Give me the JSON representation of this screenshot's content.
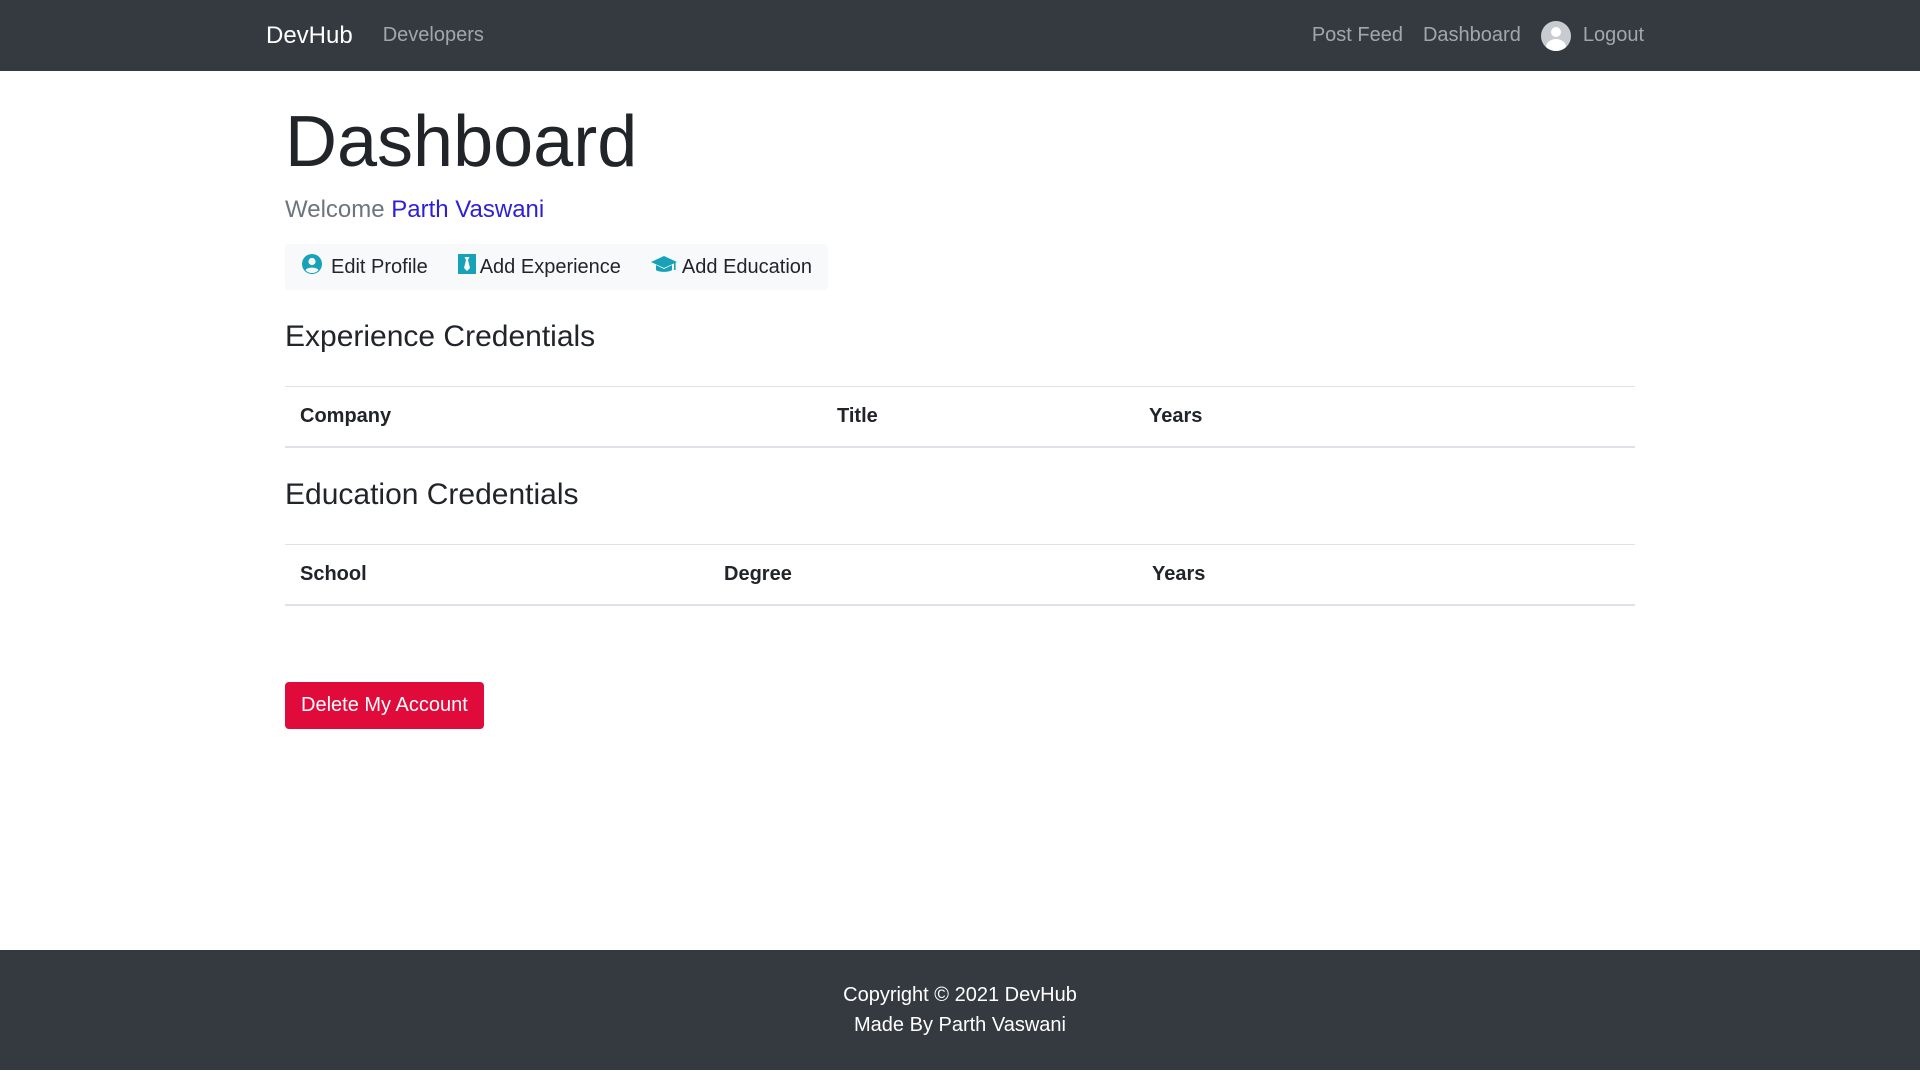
{
  "navbar": {
    "brand": "DevHub",
    "developers": "Developers",
    "post_feed": "Post Feed",
    "dashboard": "Dashboard",
    "logout": "Logout"
  },
  "page": {
    "title": "Dashboard",
    "welcome_prefix": "Welcome",
    "user_name": "Parth Vaswani"
  },
  "actions": {
    "edit_profile": "Edit Profile",
    "add_experience": "Add Experience",
    "add_education": "Add Education"
  },
  "experience": {
    "title": "Experience Credentials",
    "columns": [
      "Company",
      "Title",
      "Years"
    ]
  },
  "education": {
    "title": "Education Credentials",
    "columns": [
      "School",
      "Degree",
      "Years"
    ]
  },
  "delete_button": "Delete My Account",
  "footer": {
    "copyright": "Copyright © 2021 DevHub",
    "made_by": "Made By Parth Vaswani"
  },
  "colors": {
    "navbar_bg": "#343a40",
    "accent_link": "#2d1fd8",
    "icon_teal": "#17a2b8",
    "danger": "#e00b3a"
  },
  "icons": {
    "avatar": "user-avatar-icon",
    "edit_profile": "user-circle-icon",
    "add_experience": "black-tie-icon",
    "add_education": "graduation-cap-icon"
  }
}
